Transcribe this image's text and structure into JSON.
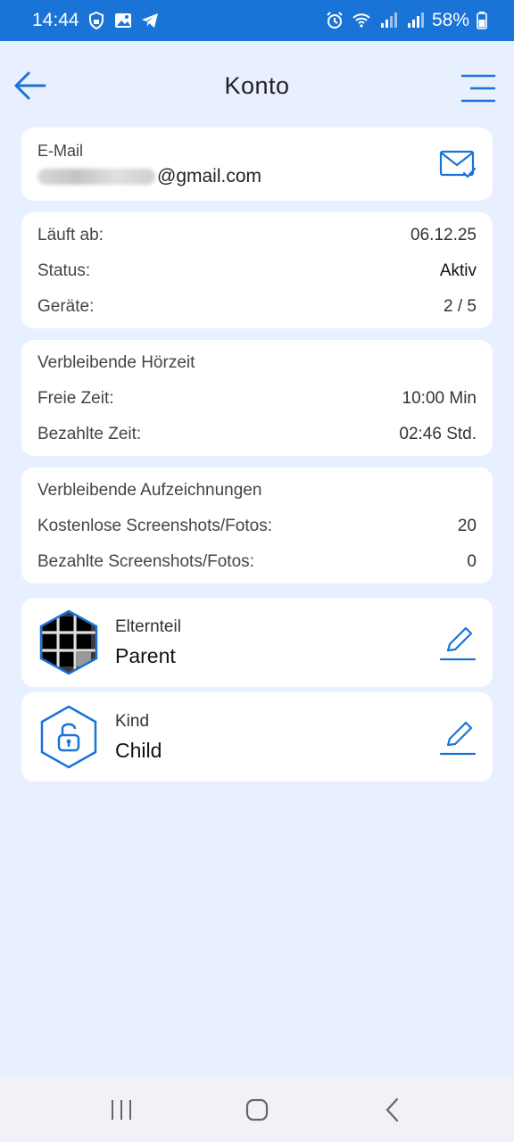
{
  "status_bar": {
    "time": "14:44",
    "battery": "58%",
    "icons": [
      "vpn-lock-icon",
      "image-icon",
      "telegram-icon",
      "alarm-icon",
      "wifi-icon",
      "signal-icon",
      "signal-icon",
      "battery-icon"
    ]
  },
  "header": {
    "title": "Konto",
    "back_icon": "arrow-left-icon",
    "menu_icon": "menu-icon"
  },
  "email": {
    "label": "E-Mail",
    "value_visible": "@gmail.com",
    "icon": "mail-check-icon"
  },
  "subscription": {
    "rows": [
      {
        "label": "Läuft ab:",
        "value": "06.12.25"
      },
      {
        "label": "Status:",
        "value": "Aktiv"
      },
      {
        "label": "Geräte:",
        "value": "2 / 5"
      }
    ]
  },
  "listening": {
    "title": "Verbleibende Hörzeit",
    "rows": [
      {
        "label": "Freie Zeit:",
        "value": "10:00 Min"
      },
      {
        "label": "Bezahlte Zeit:",
        "value": "02:46 Std."
      }
    ]
  },
  "recordings": {
    "title": "Verbleibende Aufzeichnungen",
    "rows": [
      {
        "label": "Kostenlose Screenshots/Fotos:",
        "value": "20"
      },
      {
        "label": "Bezahlte Screenshots/Fotos:",
        "value": "0"
      }
    ]
  },
  "users": [
    {
      "role": "Elternteil",
      "name": "Parent",
      "avatar": "grid-avatar-icon",
      "edit_icon": "pencil-icon"
    },
    {
      "role": "Kind",
      "name": "Child",
      "avatar": "lock-avatar-icon",
      "edit_icon": "pencil-icon"
    }
  ],
  "nav": {
    "recents_icon": "recents-icon",
    "home_icon": "home-icon",
    "back_icon": "back-chevron-icon"
  },
  "colors": {
    "accent": "#1a73d6",
    "background": "#e8efff",
    "card": "#ffffff"
  }
}
